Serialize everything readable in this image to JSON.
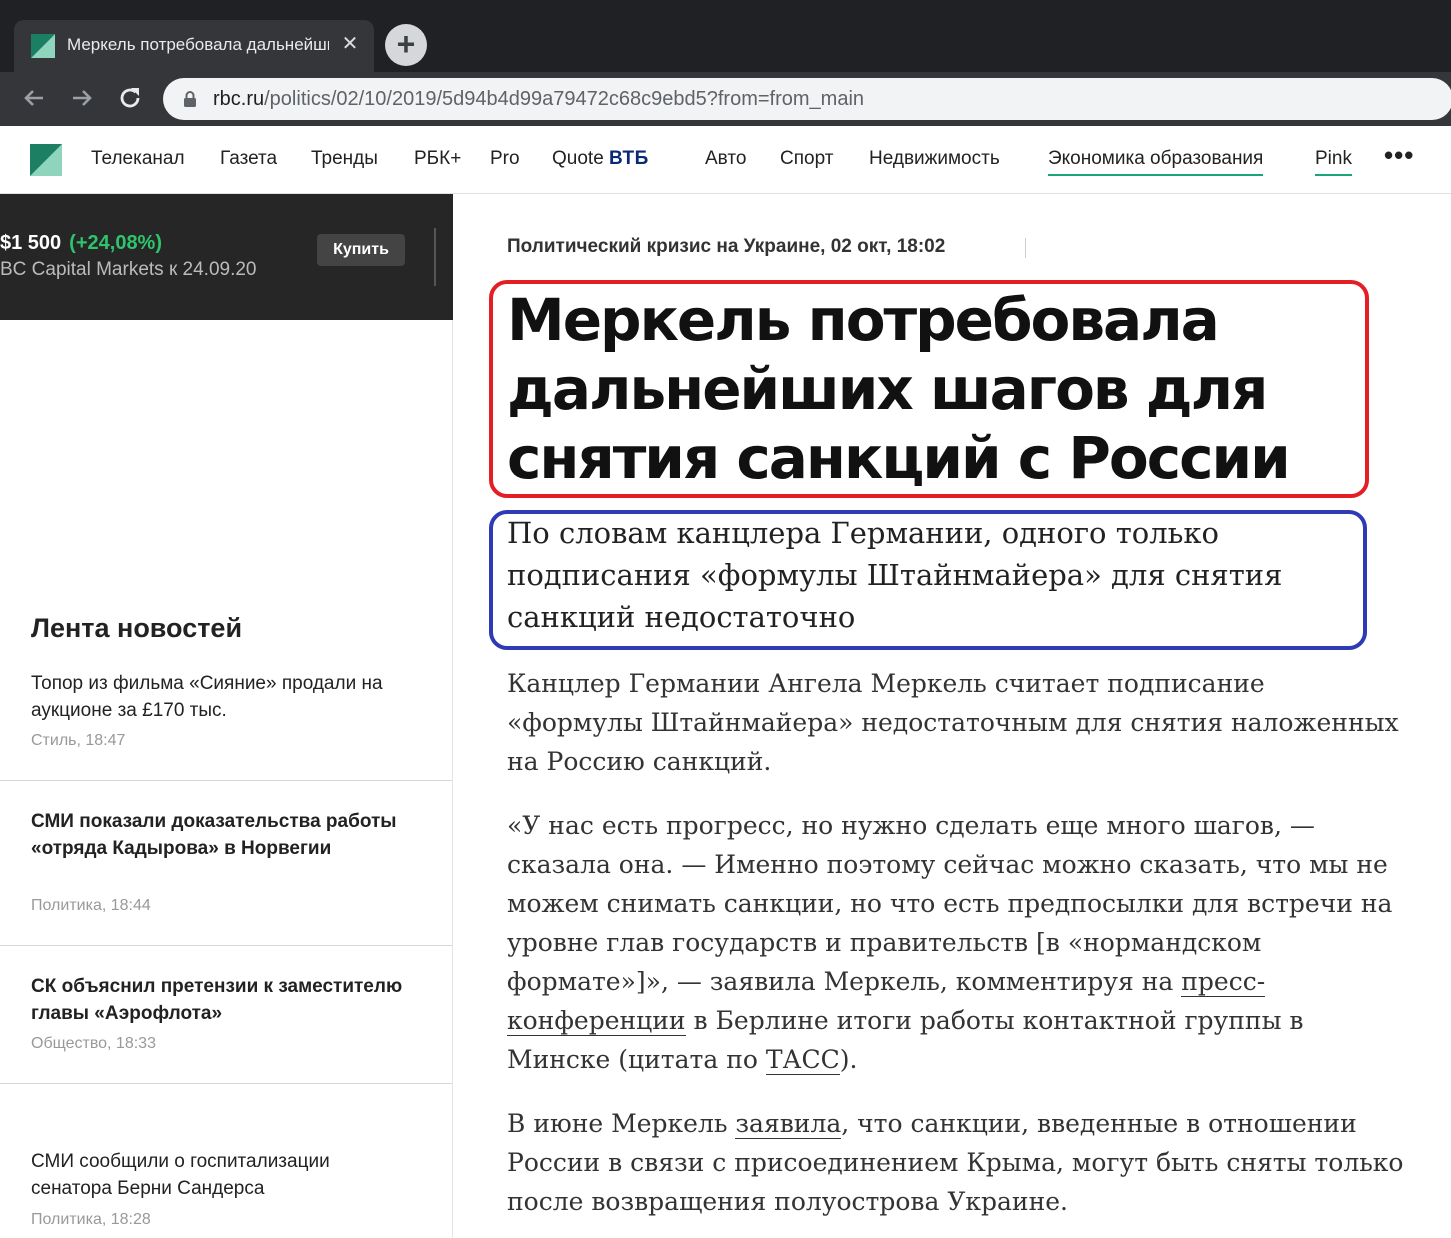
{
  "browser": {
    "tab_title": "Меркель потребовала дальнейших шагов для снятия санкций с России",
    "tab_close": "✕",
    "new_tab": "+",
    "url_domain": "rbc.ru",
    "url_path": "/politics/02/10/2019/5d94b4d99a79472c68c9ebd5?from=from_main"
  },
  "header": {
    "nav": [
      {
        "label": "Телеканал"
      },
      {
        "label": "Газета"
      },
      {
        "label": "Тренды"
      },
      {
        "label": "РБК+"
      },
      {
        "label": "Pro"
      },
      {
        "label": "Quote"
      },
      {
        "label": "Авто"
      },
      {
        "label": "Спорт"
      },
      {
        "label": "Недвижимость"
      },
      {
        "label": "Экономика образования"
      },
      {
        "label": "Pink"
      }
    ],
    "vtb": "ВТБ",
    "more": "•••"
  },
  "promo": {
    "price": "$1 500",
    "change": "(+24,08%)",
    "subtitle": "BC Capital Markets к 24.09.20",
    "buy": "Купить"
  },
  "feed": {
    "title": "Лента новостей",
    "items": [
      {
        "headline": "Топор из фильма «Сияние» продали на аукционе за £170 тыс.",
        "meta": "Стиль, 18:47"
      },
      {
        "headline": "СМИ показали доказательства работы «отряда Кадырова» в Норвегии",
        "meta": "Политика, 18:44"
      },
      {
        "headline": "СК объяснил претензии к заместителю главы «Аэрофлота»",
        "meta": "Общество, 18:33"
      },
      {
        "headline": "СМИ сообщили о госпитализации сенатора Берни Сандерса",
        "meta": "Политика, 18:28"
      }
    ]
  },
  "article": {
    "rubric": "Политический кризис на Украине, 02 окт, 18:02",
    "title": "Меркель потребовала дальнейших шагов для снятия санкций с России",
    "lead": "По словам канцлера Германии, одного только подписания «формулы Штайнмайера» для снятия санкций недостаточно",
    "p1": "Канцлер Германии Ангела Меркель считает подписание «формулы Штайнмайера» недостаточным для снятия наложенных на Россию санкций.",
    "p2_a": "«У нас есть прогресс, но нужно сделать еще много шагов, — сказала она. — Именно поэтому сейчас можно сказать, что мы не можем снимать санкции, но что есть предпосылки для встречи на уровне глав государств и правительств [в «нормандском формате»]», — заявила Меркель, комментируя на ",
    "p2_link1": "пресс-конференции",
    "p2_b": " в Берлине итоги работы контактной группы в Минске (цитата по ",
    "p2_link2": "ТАСС",
    "p2_c": ").",
    "p3_a": "В июне Меркель ",
    "p3_link": "заявила",
    "p3_b": ", что санкции, введенные в отношении России в связи с присоединением Крыма, могут быть сняты только после возвращения полуострова Украине."
  },
  "colors": {
    "accent_green": "#19a47c",
    "headline_box": "#e31e24",
    "lead_box": "#2e3bb5",
    "promo_green": "#2fc46b"
  }
}
